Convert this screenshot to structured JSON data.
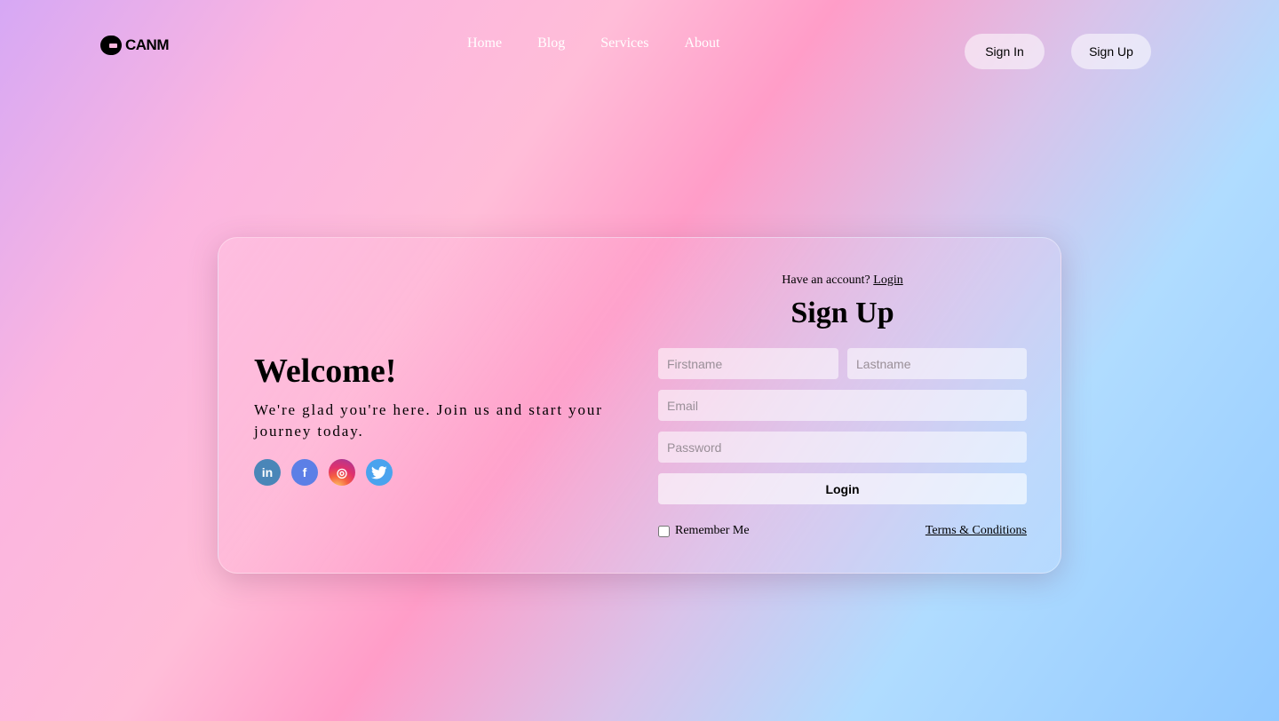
{
  "header": {
    "logo_text": "CANM",
    "nav": [
      "Home",
      "Blog",
      "Services",
      "About"
    ],
    "sign_in_label": "Sign In",
    "sign_up_label": "Sign Up"
  },
  "welcome": {
    "title": "Welcome!",
    "subtitle": "We're glad you're here. Join us and start your journey today.",
    "socials": [
      {
        "name": "linkedin-icon",
        "glyph": "in"
      },
      {
        "name": "facebook-icon",
        "glyph": "f"
      },
      {
        "name": "instagram-icon",
        "glyph": "◎"
      },
      {
        "name": "twitter-icon",
        "glyph": "🐦"
      }
    ]
  },
  "form": {
    "have_account_text": "Have an account?",
    "login_link": "Login",
    "title": "Sign Up",
    "firstname_placeholder": "Firstname",
    "lastname_placeholder": "Lastname",
    "email_placeholder": "Email",
    "password_placeholder": "Password",
    "submit_label": "Login",
    "remember_label": "Remember Me",
    "remember_checked": false,
    "terms_label": "Terms & Conditions"
  },
  "colors": {
    "linkedin": "#4a86b8",
    "facebook": "#5c7fe6",
    "twitter": "#4aa3ee"
  }
}
